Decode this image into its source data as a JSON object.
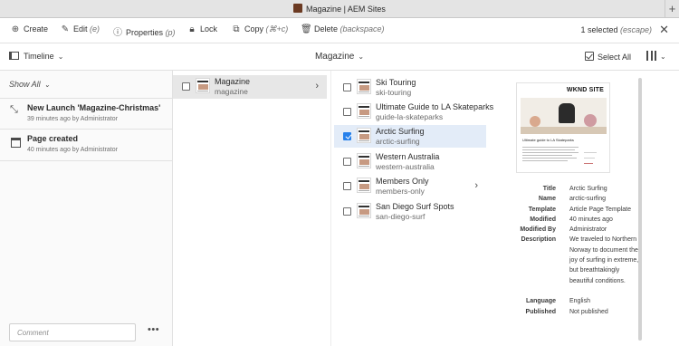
{
  "window": {
    "title": "Magazine | AEM Sites",
    "new_tab_glyph": "+"
  },
  "actions": [
    {
      "label": "Create",
      "shortcut": "",
      "icon": "plus-circle-icon"
    },
    {
      "label": "Edit",
      "shortcut": "(e)",
      "icon": "pencil-icon"
    },
    {
      "label": "Properties",
      "shortcut": "(p)",
      "icon": "info-icon"
    },
    {
      "label": "Lock",
      "shortcut": "",
      "icon": "lock-icon"
    },
    {
      "label": "Copy",
      "shortcut": "(⌘+c)",
      "icon": "copy-icon"
    },
    {
      "label": "Delete",
      "shortcut": "(backspace)",
      "icon": "trash-icon"
    }
  ],
  "selection": {
    "count_text": "1 selected",
    "shortcut": "(escape)"
  },
  "viewbar": {
    "rail_label": "Timeline",
    "breadcrumb": "Magazine",
    "select_all": "Select All"
  },
  "rail": {
    "filter": "Show All",
    "items": [
      {
        "title": "New Launch 'Magazine-Christmas'",
        "subtitle": "39 minutes ago by Administrator",
        "icon": "launch-icon"
      },
      {
        "title": "Page created",
        "subtitle": "40 minutes ago by Administrator",
        "icon": "page-icon"
      }
    ],
    "comment_placeholder": "Comment",
    "more": "•••"
  },
  "column1": {
    "title": "Magazine",
    "name": "magazine"
  },
  "column2": [
    {
      "title": "Ski Touring",
      "name": "ski-touring",
      "selected": false,
      "has_children": false
    },
    {
      "title": "Ultimate Guide to LA Skateparks",
      "name": "guide-la-skateparks",
      "selected": false,
      "has_children": false
    },
    {
      "title": "Arctic Surfing",
      "name": "arctic-surfing",
      "selected": true,
      "has_children": false
    },
    {
      "title": "Western Australia",
      "name": "western-australia",
      "selected": false,
      "has_children": false
    },
    {
      "title": "Members Only",
      "name": "members-only",
      "selected": false,
      "has_children": true
    },
    {
      "title": "San Diego Surf Spots",
      "name": "san-diego-surf",
      "selected": false,
      "has_children": false
    }
  ],
  "preview": {
    "logo": "WKND SITE",
    "headline": "Ultimate guide to LA Skateparks",
    "meta": [
      {
        "key": "Title",
        "value": "Arctic Surfing"
      },
      {
        "key": "Name",
        "value": "arctic-surfing"
      },
      {
        "key": "Template",
        "value": "Article Page Template"
      },
      {
        "key": "Modified",
        "value": "40 minutes ago"
      },
      {
        "key": "Modified By",
        "value": "Administrator"
      },
      {
        "key": "Description",
        "value": "We traveled to Northern Norway to document the joy of surfing in extreme, but breathtakingly beautiful conditions."
      },
      {
        "key": "Language",
        "value": "English"
      },
      {
        "key": "Published",
        "value": "Not published"
      }
    ]
  },
  "colors": {
    "accent": "#2680eb",
    "selected_row": "#e3ecf8"
  }
}
